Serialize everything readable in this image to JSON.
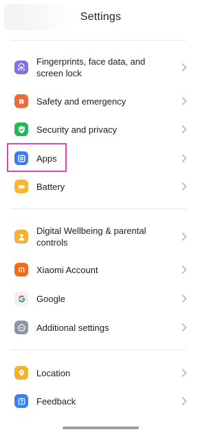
{
  "header": {
    "title": "Settings"
  },
  "groups": [
    {
      "items": [
        {
          "label": "Fingerprints, face data, and screen lock",
          "icon": "fingerprint-icon",
          "color": "#7d72e8"
        },
        {
          "label": "Safety and emergency",
          "icon": "emergency-icon",
          "color": "#f26a37"
        },
        {
          "label": "Security and privacy",
          "icon": "shield-check-icon",
          "color": "#22b85a"
        },
        {
          "label": "Apps",
          "icon": "apps-gear-icon",
          "color": "#3a7ef2"
        },
        {
          "label": "Battery",
          "icon": "battery-icon",
          "color": "#f5b82e"
        }
      ]
    },
    {
      "items": [
        {
          "label": "Digital Wellbeing & parental controls",
          "icon": "wellbeing-person-icon",
          "color": "#f4b13a"
        },
        {
          "label": "Xiaomi Account",
          "icon": "xiaomi-mi-icon",
          "color": "#f26b1d"
        },
        {
          "label": "Google",
          "icon": "google-g-icon",
          "color": "#f1f1f3"
        },
        {
          "label": "Additional settings",
          "icon": "more-dots-icon",
          "color": "#8e96a3"
        }
      ]
    },
    {
      "items": [
        {
          "label": "Location",
          "icon": "location-pin-icon",
          "color": "#f4b22e"
        },
        {
          "label": "Feedback",
          "icon": "feedback-question-icon",
          "color": "#3b7ff0"
        }
      ]
    }
  ],
  "highlight_color": "#e83fb1"
}
